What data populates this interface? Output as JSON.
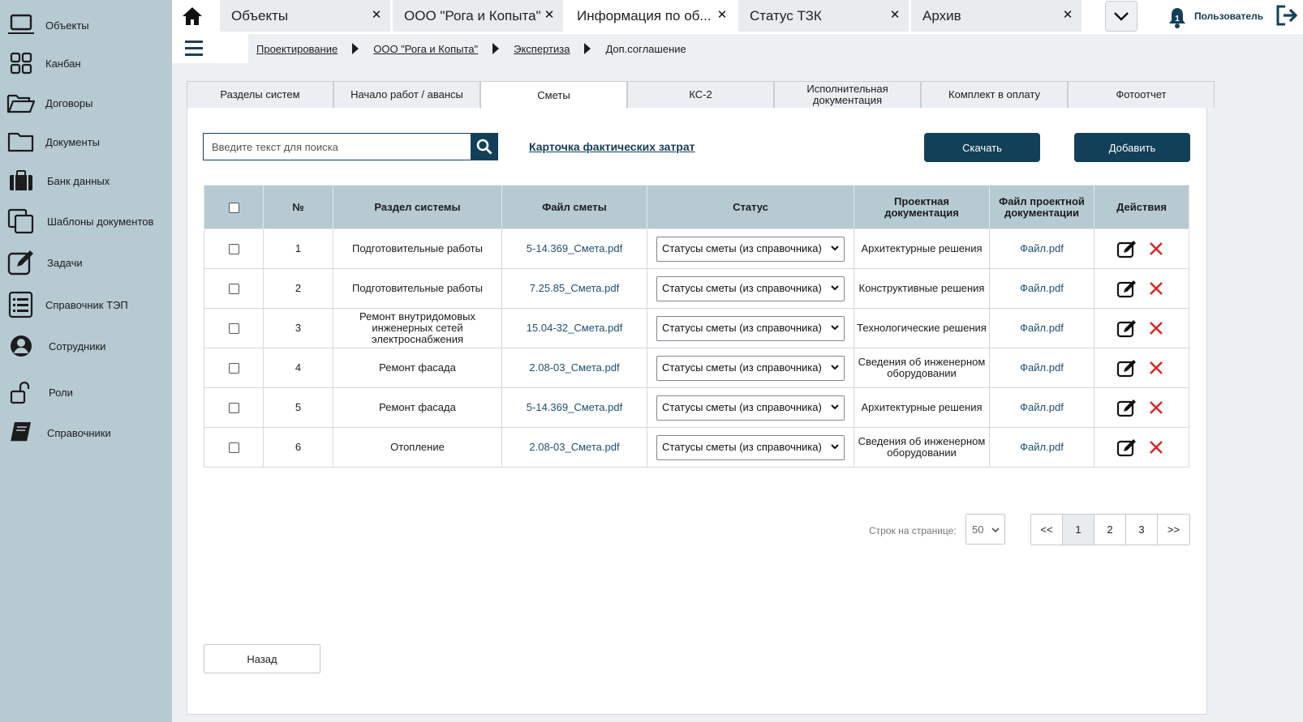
{
  "sidebar": {
    "items": [
      {
        "label": "Объекты",
        "icon": "laptop-icon"
      },
      {
        "label": "Канбан",
        "icon": "kanban-grid-icon"
      },
      {
        "label": "Договоры",
        "icon": "folder-open-icon"
      },
      {
        "label": "Документы",
        "icon": "folder-icon"
      },
      {
        "label": "Банк данных",
        "icon": "briefcase-icon"
      },
      {
        "label": "Шаблоны документов",
        "icon": "copy-icon"
      },
      {
        "label": "Задачи",
        "icon": "edit-icon"
      },
      {
        "label": "Справочник ТЭП",
        "icon": "list-icon"
      },
      {
        "label": "Сотрудники",
        "icon": "user-circle-icon"
      },
      {
        "label": "Роли",
        "icon": "unlock-icon"
      },
      {
        "label": "Справочники",
        "icon": "book-icon"
      }
    ]
  },
  "topbar": {
    "tabs": [
      {
        "label": "Объекты"
      },
      {
        "label": "ООО \"Рога и Копыта\""
      },
      {
        "label": "Информация по об..."
      },
      {
        "label": "Статус ТЗК"
      },
      {
        "label": "Архив"
      }
    ],
    "user_label": "Пользователь"
  },
  "breadcrumb": {
    "items": [
      "Проектирование",
      "ООО \"Рога и Копыта\"",
      "Экспертиза",
      "Доп.соглашение"
    ]
  },
  "tabs": [
    {
      "label": "Разделы систем"
    },
    {
      "label": "Начало работ / авансы"
    },
    {
      "label": "Сметы"
    },
    {
      "label": "КС-2"
    },
    {
      "label": "Исполнительная документация"
    },
    {
      "label": "Комплект в оплату"
    },
    {
      "label": "Фотоотчет"
    }
  ],
  "toolbar": {
    "search_placeholder": "Введите текст для поиска",
    "card_link": "Карточка фактических затрат",
    "download_label": "Скачать",
    "add_label": "Добавить"
  },
  "table": {
    "headers": {
      "num": "№",
      "section": "Раздел системы",
      "file": "Файл сметы",
      "status": "Статус",
      "project_doc": "Проектная документация",
      "project_file": "Файл проектной документации",
      "actions": "Действия"
    },
    "rows": [
      {
        "num": "1",
        "section": "Подготовительные работы",
        "file": "5-14.369_Смета.pdf",
        "status": "Статусы сметы (из справочника)",
        "project_doc": "Архитектурные решения",
        "project_file": "Файл.pdf"
      },
      {
        "num": "2",
        "section": "Подготовительные работы",
        "file": "7.25.85_Смета.pdf",
        "status": "Статусы сметы (из справочника)",
        "project_doc": "Конструктивные решения",
        "project_file": "Файл.pdf"
      },
      {
        "num": "3",
        "section": "Ремонт внутридомовых инженерных сетей электроснабжения",
        "file": "15.04-32_Смета.pdf",
        "status": "Статусы сметы (из справочника)",
        "project_doc": "Технологические решения",
        "project_file": "Файл.pdf"
      },
      {
        "num": "4",
        "section": "Ремонт фасада",
        "file": "2.08-03_Смета.pdf",
        "status": "Статусы сметы (из справочника)",
        "project_doc": "Сведения об инженерном оборудовании",
        "project_file": "Файл.pdf"
      },
      {
        "num": "5",
        "section": "Ремонт фасада",
        "file": "5-14.369_Смета.pdf",
        "status": "Статусы сметы (из справочника)",
        "project_doc": "Архитектурные решения",
        "project_file": "Файл.pdf"
      },
      {
        "num": "6",
        "section": "Отопление",
        "file": "2.08-03_Смета.pdf",
        "status": "Статусы сметы (из справочника)",
        "project_doc": "Сведения об инженерном оборудовании",
        "project_file": "Файл.pdf"
      }
    ]
  },
  "pagination": {
    "rows_label": "Строк на странице:",
    "rows_value": "50",
    "first": "<<",
    "pages": [
      "1",
      "2",
      "3"
    ],
    "last": ">>",
    "current": "1"
  },
  "footer": {
    "back_label": "Назад"
  },
  "colors": {
    "sidebar_bg": "#b6cad2",
    "accent": "#134059",
    "delete": "#e02020"
  }
}
